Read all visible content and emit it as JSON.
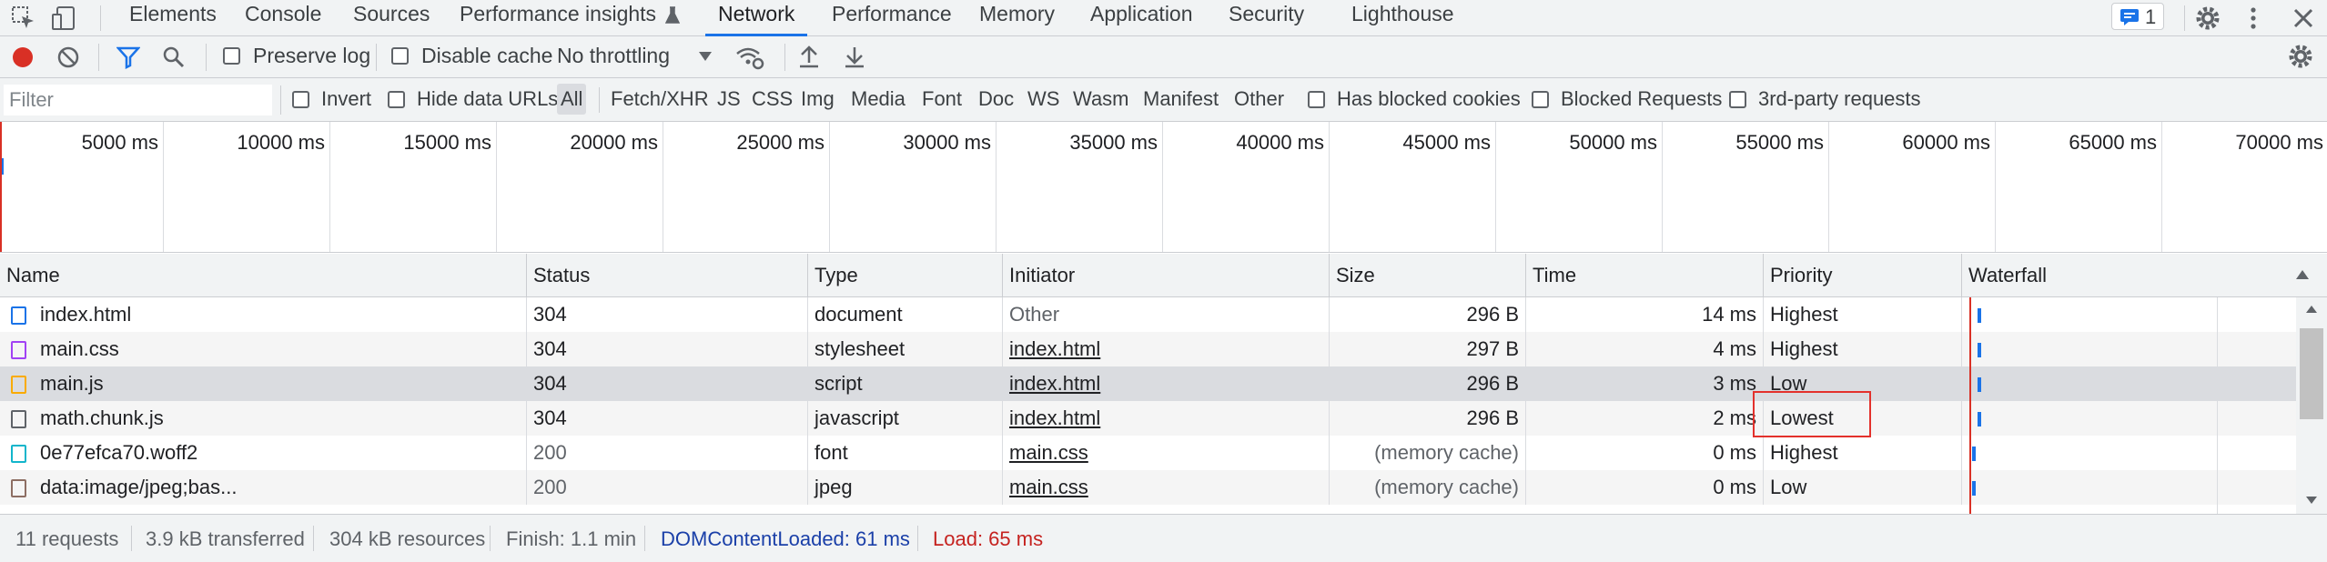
{
  "tabs": [
    "Elements",
    "Console",
    "Sources",
    "Performance insights",
    "Network",
    "Performance",
    "Memory",
    "Application",
    "Security",
    "Lighthouse"
  ],
  "active_tab": "Network",
  "issues_count": "1",
  "toolbar": {
    "preserve_log": "Preserve log",
    "disable_cache": "Disable cache",
    "throttling": "No throttling"
  },
  "filter": {
    "placeholder": "Filter",
    "invert": "Invert",
    "hide_data_urls": "Hide data URLs",
    "types": [
      "All",
      "Fetch/XHR",
      "JS",
      "CSS",
      "Img",
      "Media",
      "Font",
      "Doc",
      "WS",
      "Wasm",
      "Manifest",
      "Other"
    ],
    "active_type": "All",
    "has_blocked_cookies": "Has blocked cookies",
    "blocked_requests": "Blocked Requests",
    "third_party": "3rd-party requests"
  },
  "overview": {
    "ticks": [
      "5000 ms",
      "10000 ms",
      "15000 ms",
      "20000 ms",
      "25000 ms",
      "30000 ms",
      "35000 ms",
      "40000 ms",
      "45000 ms",
      "50000 ms",
      "55000 ms",
      "60000 ms",
      "65000 ms",
      "70000 ms"
    ]
  },
  "columns": [
    "Name",
    "Status",
    "Type",
    "Initiator",
    "Size",
    "Time",
    "Priority",
    "Waterfall"
  ],
  "rows": [
    {
      "name": "index.html",
      "status": "304",
      "type": "document",
      "initiator": "Other",
      "size": "296 B",
      "time": "14 ms",
      "priority": "Highest",
      "icon": "document-icon",
      "icon_color": "#1a73e8"
    },
    {
      "name": "main.css",
      "status": "304",
      "type": "stylesheet",
      "initiator": "index.html",
      "size": "297 B",
      "time": "4 ms",
      "priority": "Highest",
      "icon": "stylesheet-icon",
      "icon_color": "#a142f4"
    },
    {
      "name": "main.js",
      "status": "304",
      "type": "script",
      "initiator": "index.html",
      "size": "296 B",
      "time": "3 ms",
      "priority": "Low",
      "icon": "script-icon",
      "icon_color": "#f9ab00"
    },
    {
      "name": "math.chunk.js",
      "status": "304",
      "type": "javascript",
      "initiator": "index.html",
      "size": "296 B",
      "time": "2 ms",
      "priority": "Lowest",
      "icon": "file-icon",
      "icon_color": "#5f6368"
    },
    {
      "name": "0e77efca70.woff2",
      "status": "200",
      "type": "font",
      "initiator": "main.css",
      "size": "(memory cache)",
      "time": "0 ms",
      "priority": "Highest",
      "icon": "font-icon",
      "icon_color": "#12b5cb"
    },
    {
      "name": "data:image/jpeg;bas...",
      "status": "200",
      "type": "jpeg",
      "initiator": "main.css",
      "size": "(memory cache)",
      "time": "0 ms",
      "priority": "Low",
      "icon": "image-icon",
      "icon_color": "#8d6e63"
    }
  ],
  "status": {
    "requests": "11 requests",
    "transferred": "3.9 kB transferred",
    "resources": "304 kB resources",
    "finish": "Finish: 1.1 min",
    "dom_loaded": "DOMContentLoaded: 61 ms",
    "load": "Load: 65 ms"
  }
}
